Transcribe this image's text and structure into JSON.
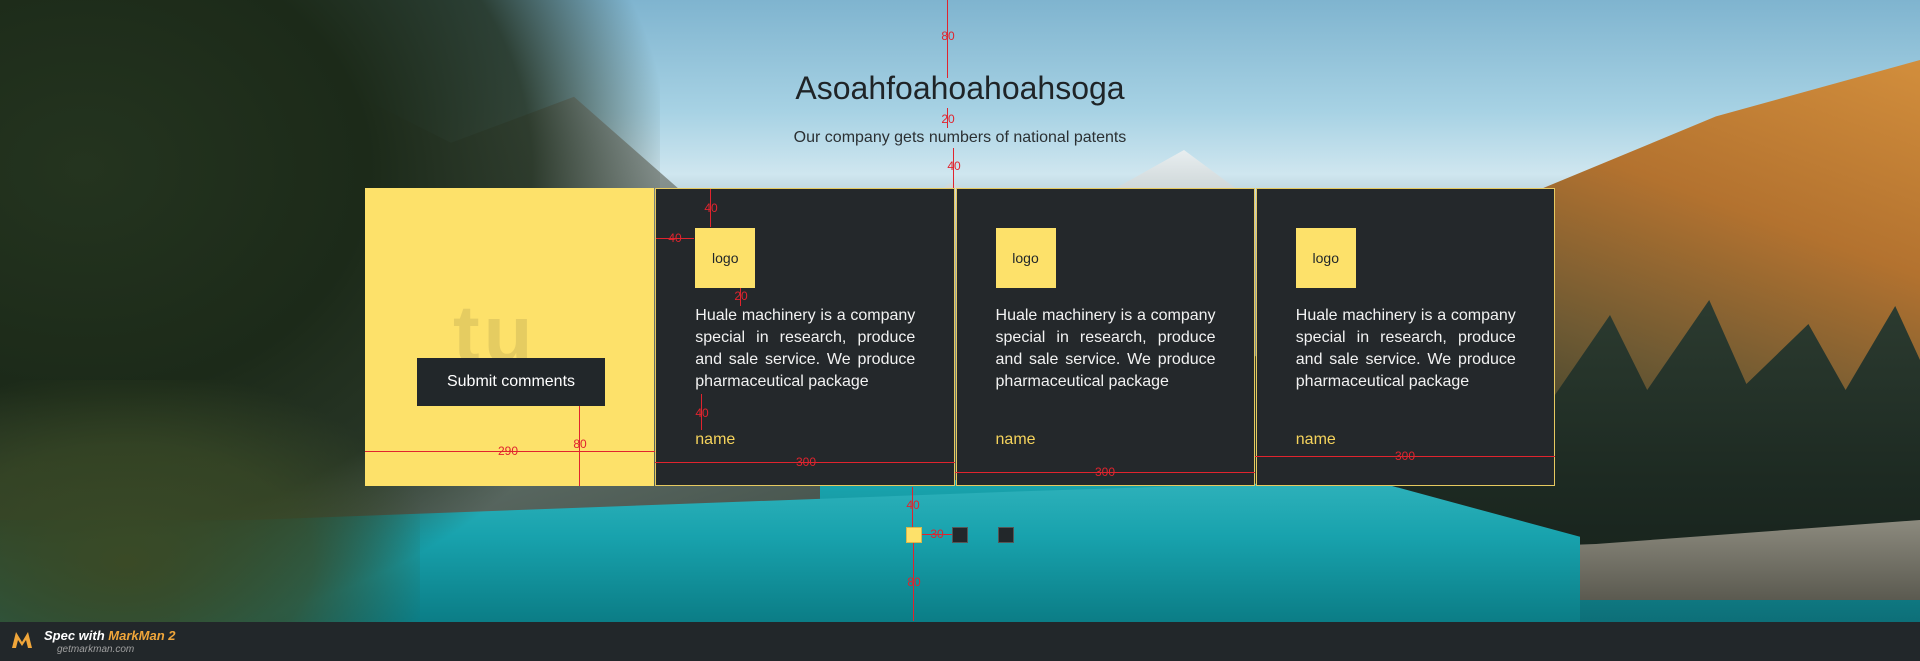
{
  "header": {
    "title": "Asoahfoahoahoahsoga",
    "subtitle": "Our company gets numbers of national patents"
  },
  "submit_panel": {
    "ghost_text": "tu",
    "button_label": "Submit comments"
  },
  "cards": [
    {
      "logo": "logo",
      "description": "Huale machinery is a company special in research, produce and sale service. We produce pharmaceutical package",
      "name": "name"
    },
    {
      "logo": "logo",
      "description": "Huale machinery is a company special in research, produce and sale service. We produce pharmaceutical package",
      "name": "name"
    },
    {
      "logo": "logo",
      "description": "Huale machinery is a company special in research, produce and sale service. We produce pharmaceutical package",
      "name": "name"
    }
  ],
  "pager": {
    "active_index": 0,
    "count": 3
  },
  "annotations": {
    "top_margin": "80",
    "title_gap": "20",
    "subtitle_gap": "40",
    "logo_top": "40",
    "logo_left": "40",
    "logo_gap": "20",
    "text_gap": "40",
    "panel_width": "290",
    "button_bottom": "80",
    "card_width_1": "300",
    "card_width_2": "300",
    "card_width_3": "300",
    "pager_top": "40",
    "pager_gap": "30",
    "bottom_margin": "80"
  },
  "footer": {
    "brand_prefix": "Spec with ",
    "brand_name": "MarkMan 2",
    "url": "getmarkman.com"
  },
  "colors": {
    "accent_yellow": "#fde16a",
    "card_dark": "#24282b",
    "annotation_red": "#e0242e",
    "name_yellow": "#f5d35c"
  }
}
